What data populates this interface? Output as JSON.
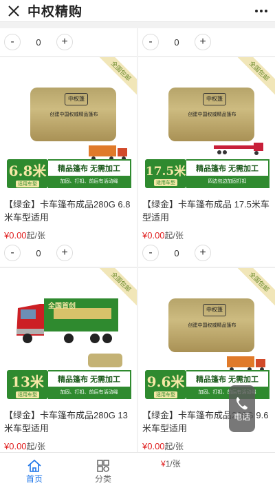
{
  "header": {
    "title": "中权精购",
    "close_icon": "close-icon",
    "more_icon": "more-icon"
  },
  "steppers": [
    {
      "minus": "-",
      "value": "0",
      "plus": "+"
    },
    {
      "minus": "-",
      "value": "0",
      "plus": "+"
    },
    {
      "minus": "-",
      "value": "0",
      "plus": "+"
    },
    {
      "minus": "-",
      "value": "0",
      "plus": "+"
    }
  ],
  "products": [
    {
      "ribbon": "全国包邮",
      "bag_logo": "中权篷",
      "bag_caption": "创建中国权威精品篷布",
      "size": "6.8米",
      "size_sub": "适用车型",
      "banner_title": "精品篷布 无需加工",
      "banner_sub": "加固、打扣、前后有活动绳",
      "name": "【绿金】卡车篷布成品280G 6.8米车型适用",
      "price": "¥0.00",
      "unit": "起/张"
    },
    {
      "ribbon": "全国包邮",
      "bag_logo": "中权篷",
      "bag_caption": "创建中国权威精品篷布",
      "size": "17.5米",
      "size_sub": "适用车型",
      "banner_title": "精品篷布 无需加工",
      "banner_sub": "四边包边加固打扣",
      "name": "【绿金】卡车篷布成品 17.5米车型适用",
      "price": "¥0.00",
      "unit": "起/张"
    },
    {
      "ribbon": "全国包邮",
      "bag_logo": "全国首创",
      "bag_caption": "",
      "size": "13米",
      "size_sub": "适用车型",
      "banner_title": "精品篷布 无需加工",
      "banner_sub": "加固、打扣、前后有活动绳",
      "name": "【绿金】卡车篷布成品280G 13米车型适用",
      "price": "¥0.00",
      "unit": "起/张"
    },
    {
      "ribbon": "全国包邮",
      "bag_logo": "中权篷",
      "bag_caption": "创建中国权威精品篷布",
      "size": "9.6米",
      "size_sub": "适用车型",
      "banner_title": "精品篷布 无需加工",
      "banner_sub": "加固、打扣、前后有活动绳",
      "name": "【绿金】卡车篷布成品280G 9.6米车型适用",
      "price": "¥0.00",
      "unit": "起/张"
    }
  ],
  "call_button": {
    "label": "电话"
  },
  "tabbar": {
    "home": "首页",
    "category": "分类"
  },
  "partial_price": {
    "yen": "¥",
    "rest": "1/张"
  },
  "colors": {
    "brand_green": "#2f8a2f",
    "price_red": "#e02020",
    "active_tab": "#1a73e8"
  }
}
